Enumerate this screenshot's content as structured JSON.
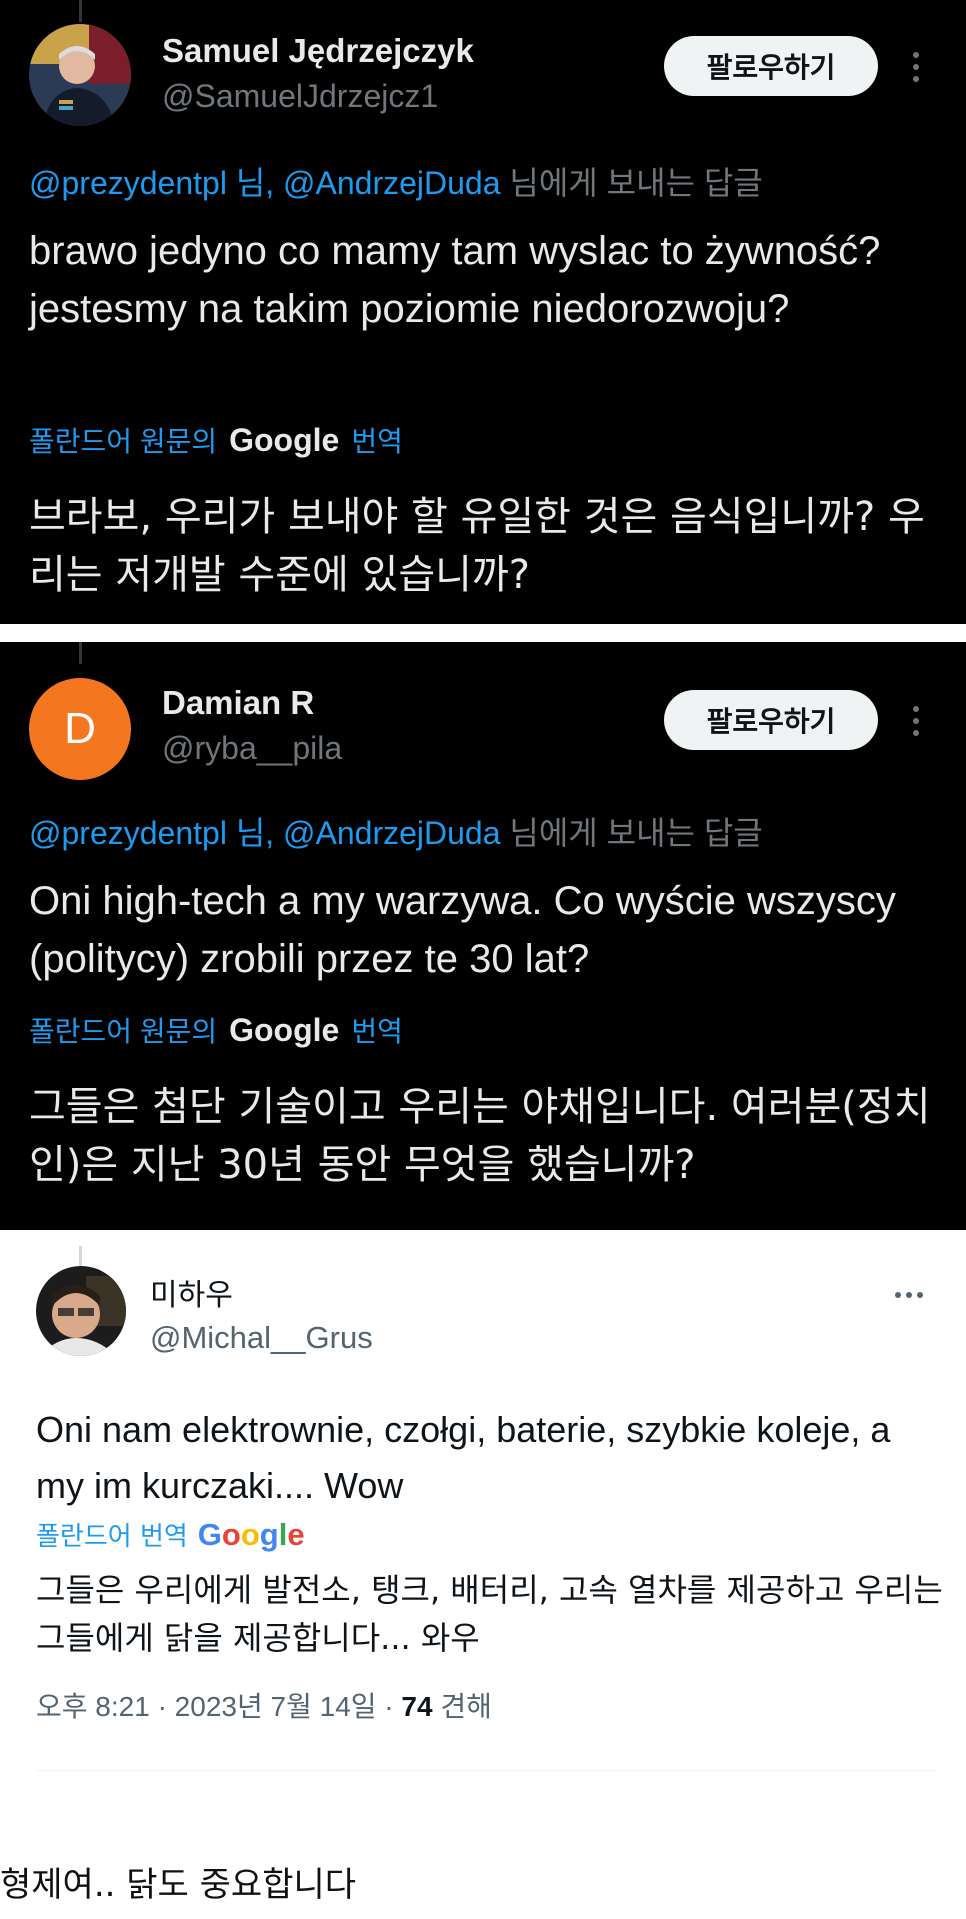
{
  "tweets": [
    {
      "author_name": "Samuel Jędrzejczyk",
      "handle": "@SamuelJdrzejcz1",
      "follow_label": "팔로우하기",
      "reply_mentions": "@prezydentpl 님, @AndrzejDuda",
      "reply_suffix": " 님에게 보내는 답글",
      "text": "brawo jedyno co mamy tam wyslac to żywność?  jestesmy na takim poziomie niedorozwoju?",
      "translate_prefix": "폴란드어 원문의",
      "translate_brand": "Google",
      "translate_suffix": "번역",
      "translated_text": "브라보, 우리가 보내야 할 유일한 것은 음식입니까? 우리는 저개발 수준에 있습니까?"
    },
    {
      "author_name": "Damian R",
      "avatar_letter": "D",
      "handle": "@ryba__pila",
      "follow_label": "팔로우하기",
      "reply_mentions": "@prezydentpl 님, @AndrzejDuda",
      "reply_suffix": " 님에게 보내는 답글",
      "text": "Oni high-tech a my warzywa. Co wyście wszyscy (politycy) zrobili przez te 30 lat?",
      "translate_prefix": "폴란드어 원문의",
      "translate_brand": "Google",
      "translate_suffix": "번역",
      "translated_text": "그들은 첨단 기술이고 우리는 야채입니다. 여러분(정치인)은 지난 30년 동안 무엇을 했습니까?"
    },
    {
      "author_name": "미하우",
      "handle": "@Michal__Grus",
      "text": "Oni nam elektrownie, czołgi, baterie, szybkie koleje, a my im kurczaki.... Wow",
      "translate_prefix": "폴란드어 번역",
      "translate_brand_letters": [
        "G",
        "o",
        "o",
        "g",
        "l",
        "e"
      ],
      "translated_text": "그들은 우리에게 발전소, 탱크, 배터리, 고속 열차를 제공하고 우리는 그들에게 닭을 제공합니다... 와우",
      "meta_time": "오후 8:21 · 2023년 7월 14일 · ",
      "meta_views": "74",
      "meta_views_suffix": " 견해"
    }
  ],
  "caption": "형제여.. 닭도 중요합니다",
  "colors": {
    "link_blue": "#1d9bf0",
    "dark_bg": "#000000",
    "avatar_orange": "#f4771f"
  }
}
